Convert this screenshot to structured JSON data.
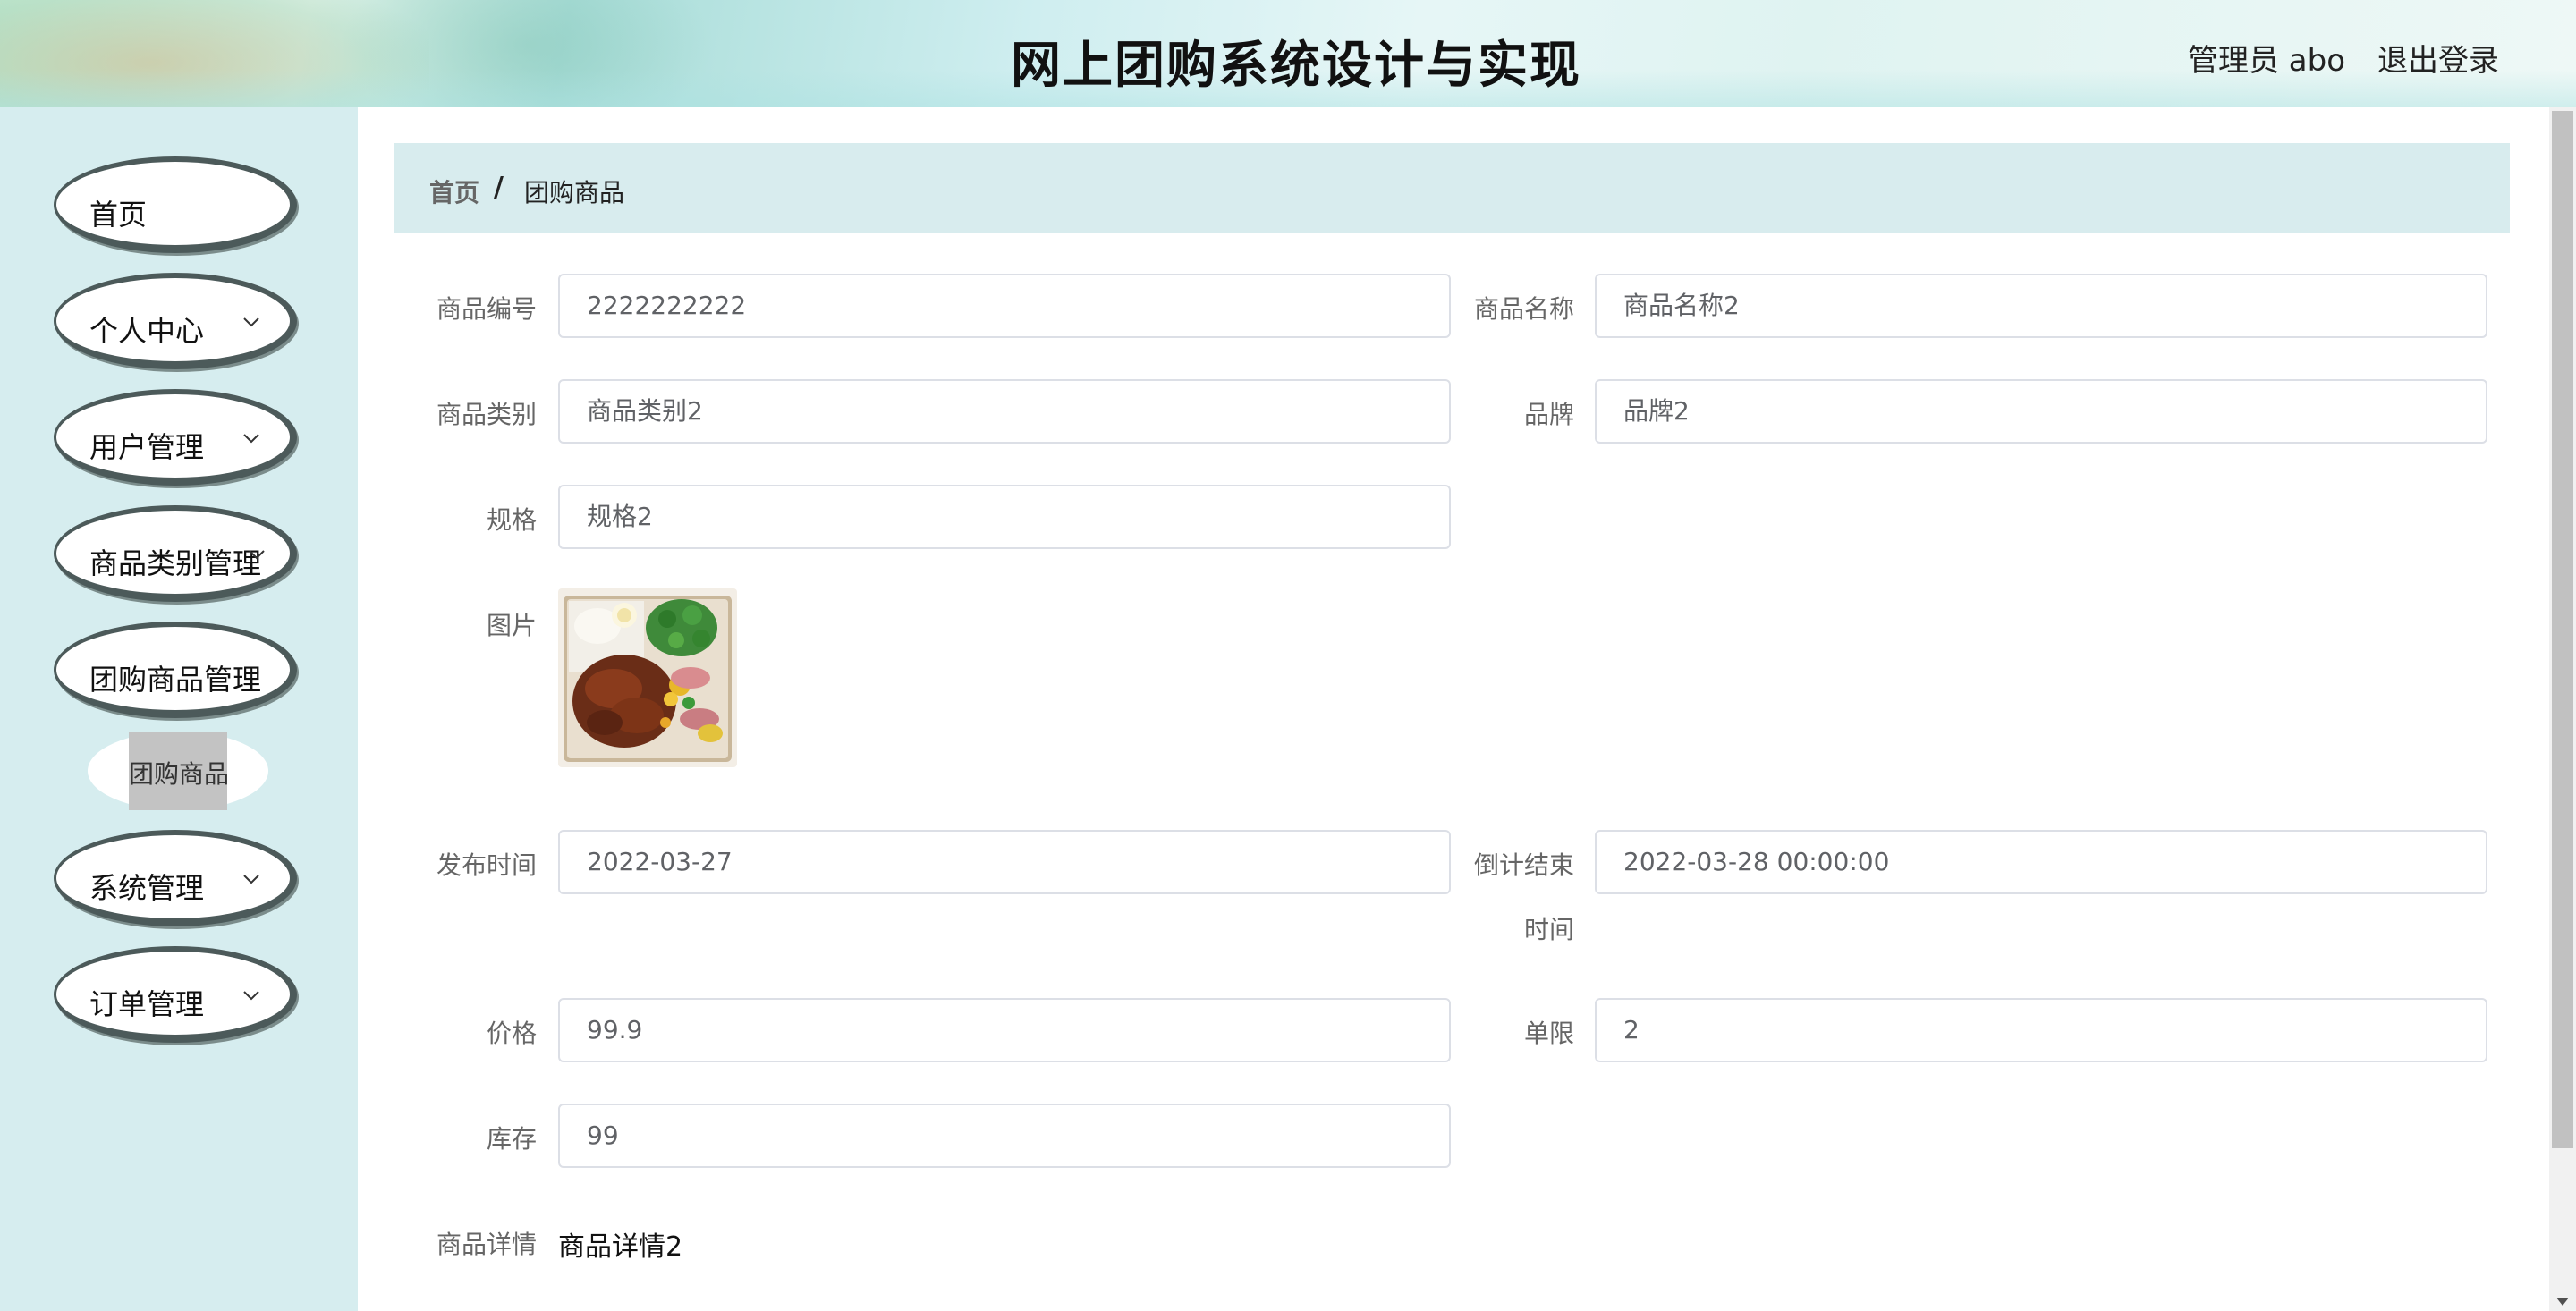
{
  "header": {
    "title": "网上团购系统设计与实现",
    "admin": "管理员 abo",
    "logout": "退出登录"
  },
  "sidebar": {
    "items": [
      {
        "label": "首页",
        "has_chevron": false
      },
      {
        "label": "个人中心",
        "has_chevron": true
      },
      {
        "label": "用户管理",
        "has_chevron": true
      },
      {
        "label": "商品类别管理",
        "has_chevron": true
      },
      {
        "label": "团购商品管理",
        "has_chevron": true
      },
      {
        "label": "系统管理",
        "has_chevron": true
      },
      {
        "label": "订单管理",
        "has_chevron": true
      }
    ],
    "subitem": {
      "label": "团购商品",
      "active": true
    }
  },
  "breadcrumb": {
    "home": "首页",
    "separator": "/",
    "current": "团购商品"
  },
  "form": {
    "product_no": {
      "label": "商品编号",
      "value": "2222222222"
    },
    "product_name": {
      "label": "商品名称",
      "value": "商品名称2"
    },
    "category": {
      "label": "商品类别",
      "value": "商品类别2"
    },
    "brand": {
      "label": "品牌",
      "value": "品牌2"
    },
    "spec": {
      "label": "规格",
      "value": "规格2"
    },
    "image": {
      "label": "图片"
    },
    "publish_time": {
      "label": "发布时间",
      "value": "2022-03-27"
    },
    "countdown_end": {
      "label_line1": "倒计结束",
      "label_line2": "时间",
      "value": "2022-03-28 00:00:00"
    },
    "price": {
      "label": "价格",
      "value": "99.9"
    },
    "limit": {
      "label": "单限",
      "value": "2"
    },
    "stock": {
      "label": "库存",
      "value": "99"
    },
    "detail": {
      "label": "商品详情",
      "value": "商品详情2"
    }
  },
  "colors": {
    "sidebar_bg": "#d6edef",
    "breadcrumb_bg": "#d8ecee",
    "nav_border": "#4c5a5a",
    "input_border": "#dcdfe6",
    "active_sub_bg": "#c3c3c3"
  },
  "icons": {
    "chevron": "chevron-down-icon"
  }
}
